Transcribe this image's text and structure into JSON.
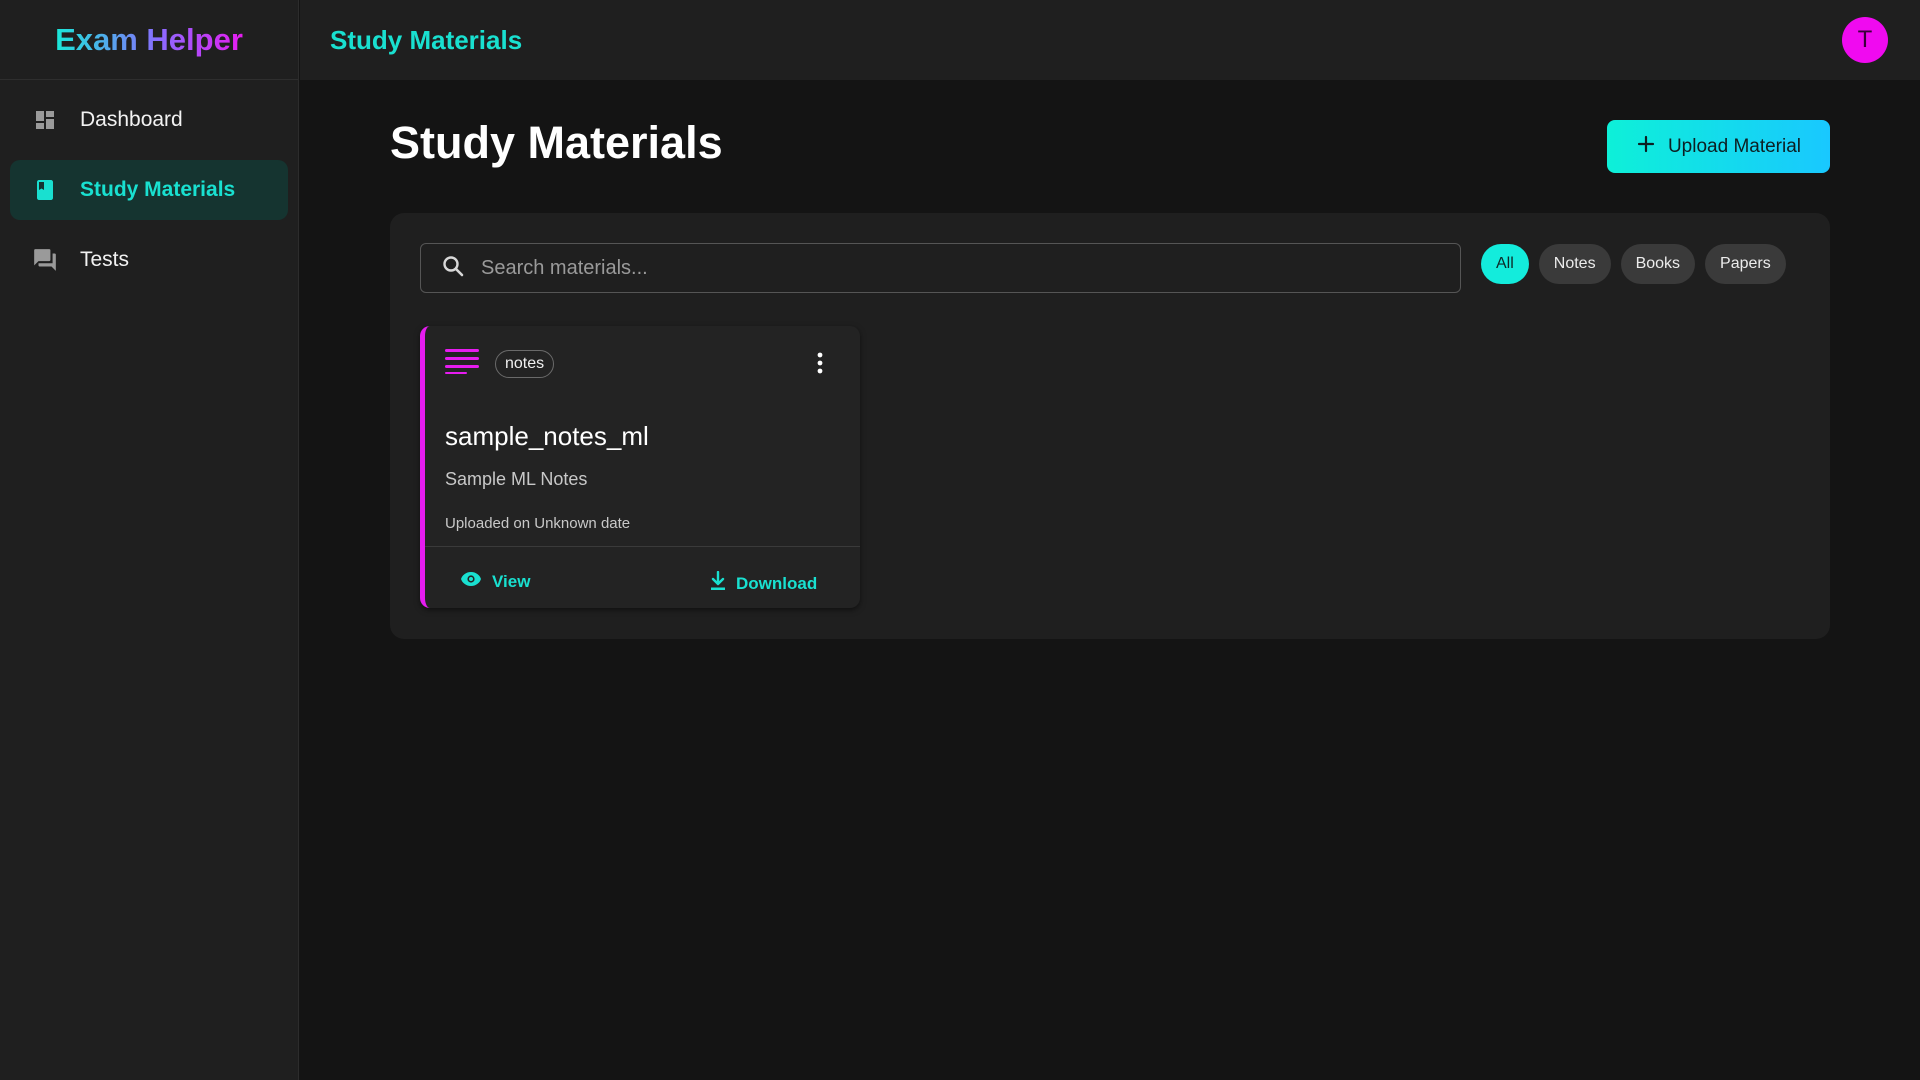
{
  "app": {
    "brand": "Exam Helper"
  },
  "sidebar": {
    "items": [
      {
        "label": "Dashboard",
        "icon": "dashboard-icon",
        "active": false
      },
      {
        "label": "Study Materials",
        "icon": "book-icon",
        "active": true
      },
      {
        "label": "Tests",
        "icon": "chat-icon",
        "active": false
      }
    ]
  },
  "topbar": {
    "title": "Study Materials",
    "avatar_letter": "T"
  },
  "main": {
    "title": "Study Materials",
    "upload_label": "Upload Material",
    "search": {
      "placeholder": "Search materials...",
      "value": ""
    },
    "filters": [
      "All",
      "Notes",
      "Books",
      "Papers"
    ],
    "active_filter": "All",
    "materials": [
      {
        "tag": "notes",
        "title": "sample_notes_ml",
        "description": "Sample ML Notes",
        "uploaded": "Uploaded on Unknown date",
        "view_label": "View",
        "download_label": "Download",
        "icon": "notes-lines-icon"
      }
    ]
  },
  "colors": {
    "accent": "#19e0d0",
    "magenta": "#e61cf0",
    "background": "#141414",
    "surface": "#1f1f1f"
  }
}
